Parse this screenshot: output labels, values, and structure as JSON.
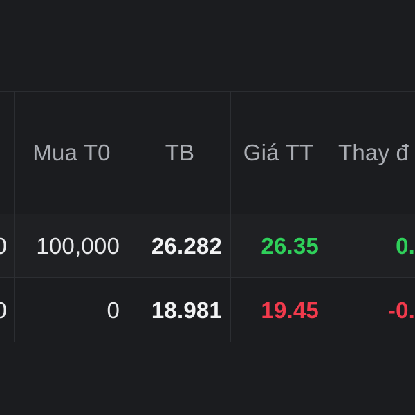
{
  "table": {
    "columns": {
      "prev": "",
      "buy_t0": "Mua T0",
      "avg": "TB",
      "market_price": "Giá TT",
      "change": "Thay đ"
    },
    "rows": [
      {
        "prev": "0",
        "buy_t0": "100,000",
        "avg": "26.282",
        "market_price": "26.35",
        "change": "0.",
        "trend": "up"
      },
      {
        "prev": "0",
        "buy_t0": "0",
        "avg": "18.981",
        "market_price": "19.45",
        "change": "-0.",
        "trend": "down"
      }
    ]
  },
  "colors": {
    "background": "#1b1c1f",
    "header_text": "#a9acb2",
    "up": "#2fd05a",
    "down": "#f23a4c",
    "value_text": "#f2f3f4"
  }
}
